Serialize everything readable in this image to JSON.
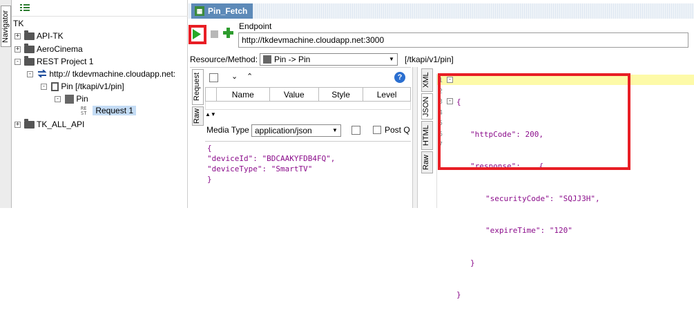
{
  "navigator": {
    "tab_label": "Navigator"
  },
  "tree": {
    "root": "TK",
    "items": [
      {
        "label": "API-TK"
      },
      {
        "label": "AeroCinema"
      },
      {
        "label": "REST Project 1"
      },
      {
        "label": "http:// tkdevmachine.cloudapp.net:"
      },
      {
        "label": "Pin [/tkapi/v1/pin]"
      },
      {
        "label": "Pin"
      },
      {
        "label": "Request 1"
      },
      {
        "label": "TK_ALL_API"
      }
    ],
    "expanders": {
      "collapsed": "+",
      "expanded": "-"
    }
  },
  "header": {
    "title": "Pin_Fetch",
    "tab_icon": "rest-icon"
  },
  "toolbar": {
    "endpoint_label": "Endpoint",
    "endpoint_value": "http://tkdevmachine.cloudapp.net:3000",
    "run": "play-icon",
    "stop": "stop-icon",
    "add": "plus-icon"
  },
  "resource": {
    "label": "Resource/Method:",
    "selected": "Pin -> Pin",
    "path": "[/tkapi/v1/pin]"
  },
  "request": {
    "side_tabs": [
      "Request",
      "Raw"
    ],
    "columns": [
      "Name",
      "Value",
      "Style",
      "Level"
    ],
    "media_type_label": "Media Type",
    "media_type_value": "application/json",
    "post_label": "Post Q",
    "body_lines": [
      "{",
      "\"deviceId\": \"BDCAAKYFDB4FQ\",",
      "\"deviceType\": \"SmartTV\"",
      "}"
    ]
  },
  "response": {
    "side_tabs": [
      "XML",
      "JSON",
      "HTML",
      "Raw"
    ],
    "line_numbers": [
      "1",
      "2",
      "3",
      "4",
      "5",
      "6",
      "7"
    ],
    "lines": [
      "{",
      "\"httpCode\": 200,",
      "\"response\":    {",
      "\"securityCode\": \"SQJJ3H\",",
      "\"expireTime\": \"120\"",
      "}",
      "}"
    ]
  },
  "colors": {
    "highlight": "#e81e25",
    "title_tab": "#5d8ab8",
    "json_text": "#8b0c8b",
    "selection": "#c4dcf5"
  }
}
